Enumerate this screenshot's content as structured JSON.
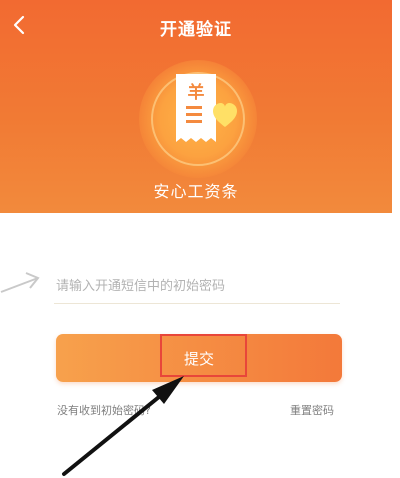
{
  "header": {
    "title": "开通验证",
    "back_icon": "chevron-left-icon",
    "app_name": "安心工资条",
    "logo_icon": "salary-receipt-icon",
    "logo_glyph": "羊"
  },
  "form": {
    "input_placeholder": "请输入开通短信中的初始密码",
    "input_value": "",
    "submit_label": "提交",
    "no_code_link": "没有收到初始密码?",
    "reset_link": "重置密码"
  },
  "annotations": {
    "highlight_color": "#e8463a",
    "pointer_arrow": "black-pointer-arrow",
    "hint_arrow": "gray-hint-arrow"
  },
  "colors": {
    "accent": "#f17a34",
    "button_start": "#f7a14c",
    "button_end": "#f3793a",
    "link_text": "#7f7f7f"
  }
}
